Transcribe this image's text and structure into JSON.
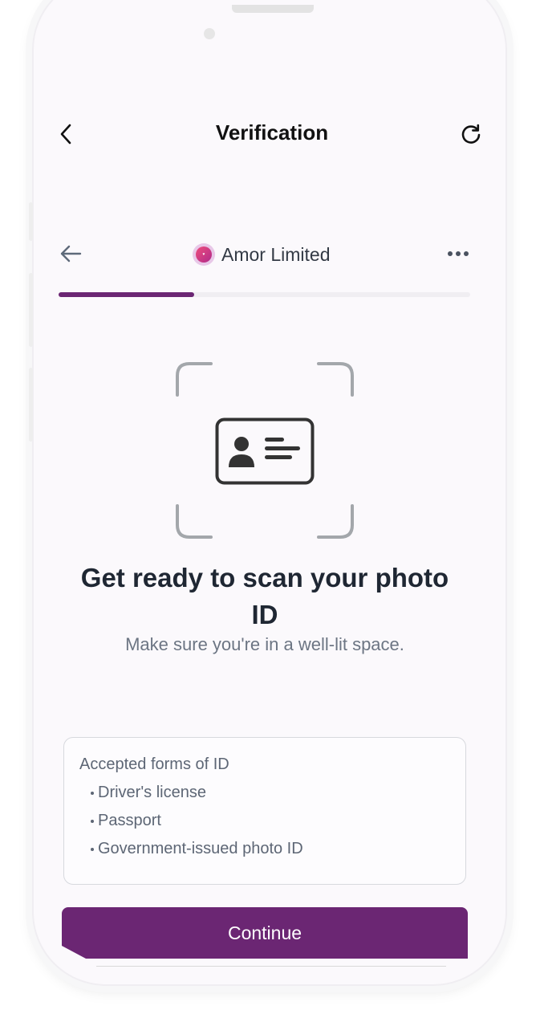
{
  "header": {
    "title": "Verification",
    "back_icon": "chevron-left-icon",
    "refresh_icon": "refresh-icon"
  },
  "provider_bar": {
    "back_icon": "arrow-left-icon",
    "brand_name": "Amor Limited",
    "brand_logo": "amor-logo",
    "menu_icon": "more-horizontal-icon"
  },
  "progress": {
    "fraction": 0.33,
    "color": "#6b2673"
  },
  "scan": {
    "icon": "id-card-icon",
    "headline": "Get ready to scan your photo ID",
    "subtext": "Make sure you're in a well-lit space."
  },
  "accepted_ids": {
    "title": "Accepted forms of ID",
    "items": [
      "Driver's license",
      "Passport",
      "Government-issued photo ID"
    ]
  },
  "actions": {
    "continue_label": "Continue"
  },
  "colors": {
    "accent": "#6b2673",
    "background": "#fbf9fc"
  }
}
